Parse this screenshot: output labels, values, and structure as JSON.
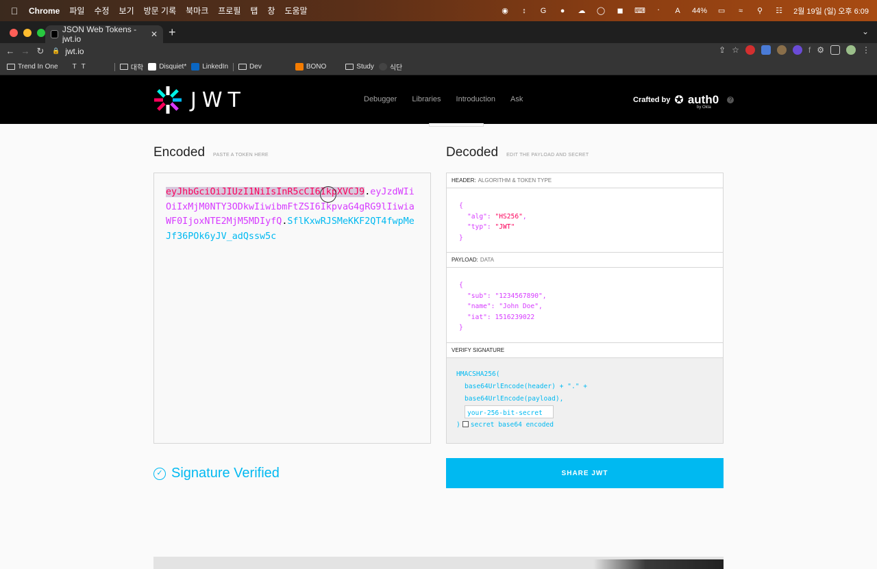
{
  "menubar": {
    "app": "Chrome",
    "items": [
      "파일",
      "수정",
      "보기",
      "방문 기록",
      "북마크",
      "프로필",
      "탭",
      "창",
      "도움말"
    ],
    "battery": "44%",
    "clock": "2월 19일 (일) 오후 6:09"
  },
  "browser": {
    "tab_title": "JSON Web Tokens - jwt.io",
    "url": "jwt.io",
    "bookmarks": [
      "Trend In One",
      "대학",
      "Disquiet*",
      "LinkedIn",
      "Dev",
      "BONO",
      "Study",
      "식단"
    ]
  },
  "site": {
    "logo_text": "JWT",
    "nav": [
      "Debugger",
      "Libraries",
      "Introduction",
      "Ask"
    ],
    "crafted_by": "Crafted by",
    "brand": "auth0",
    "brand_sub": "by Okta"
  },
  "encoded": {
    "title": "Encoded",
    "subtitle": "PASTE A TOKEN HERE",
    "token_header": "eyJhbGciOiJIUzI1NiIsInR5cCI6IkpXVCJ9",
    "token_payload": "eyJzdWIiOiIxMjM0NTY3ODkwIiwibmFtZSI6IkpvaG4gRG9lIiwiaWF0IjoxNTE2MjM5MDIyfQ",
    "token_signature": "SflKxwRJSMeKKF2QT4fwpMeJf36POk6yJV_adQssw5c"
  },
  "decoded": {
    "title": "Decoded",
    "subtitle": "EDIT THE PAYLOAD AND SECRET",
    "header_label": "HEADER:",
    "header_desc": "ALGORITHM & TOKEN TYPE",
    "header_json": {
      "alg": "HS256",
      "typ": "JWT"
    },
    "payload_label": "PAYLOAD:",
    "payload_desc": "DATA",
    "payload_json": {
      "sub": "1234567890",
      "name": "John Doe",
      "iat": "1516239022"
    },
    "verify_label": "VERIFY SIGNATURE",
    "verify_fn": "HMACSHA256(",
    "verify_line1": "base64UrlEncode(header) + \".\" +",
    "verify_line2": "base64UrlEncode(payload),",
    "secret_value": "your-256-bit-secret",
    "verify_close": ")",
    "base64_label": "secret base64 encoded"
  },
  "status": {
    "verified": "Signature Verified"
  },
  "share_label": "SHARE JWT",
  "colors": {
    "header": "#fb015b",
    "payload": "#d63aff",
    "signature": "#00b9f1",
    "accent": "#00b9f1"
  }
}
